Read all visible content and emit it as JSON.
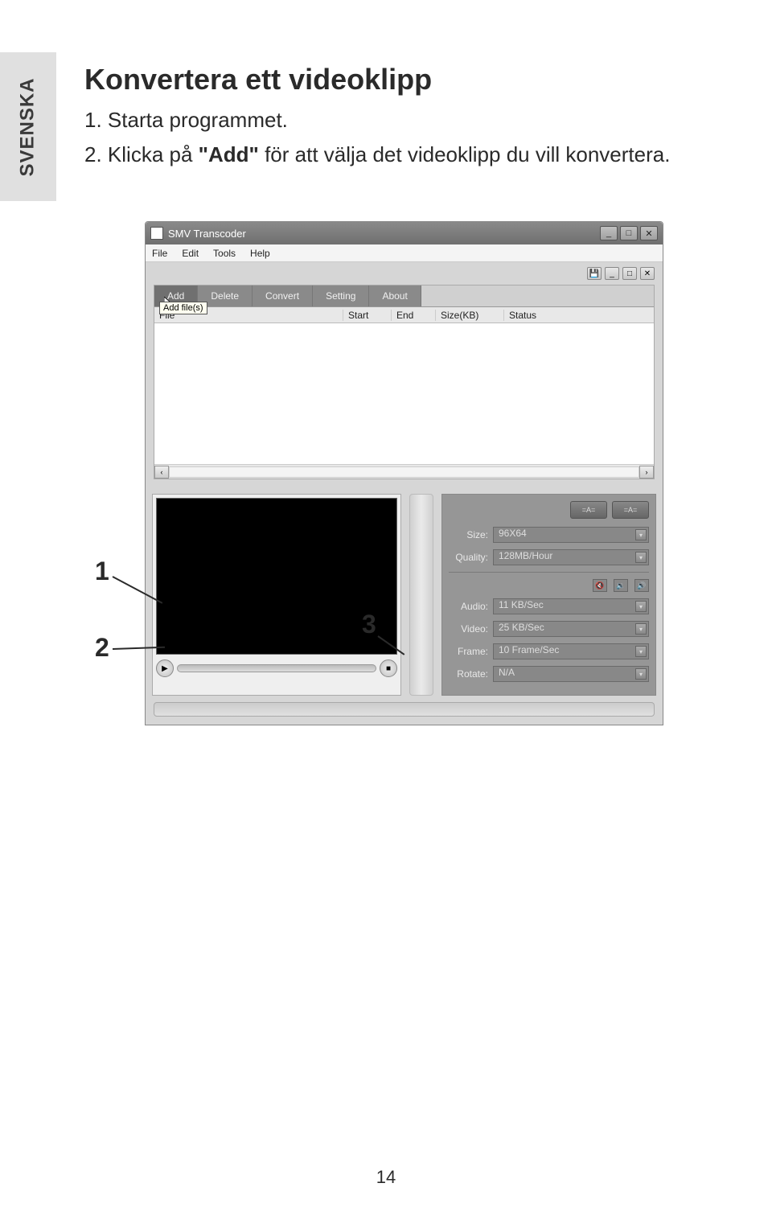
{
  "sidebar_label": "SVENSKA",
  "heading": "Konvertera ett videoklipp",
  "steps": {
    "s1_num": "1.",
    "s1_text": "Starta programmet.",
    "s2_num": "2.",
    "s2_pre": "Klicka på ",
    "s2_bold": "\"Add\"",
    "s2_post": " för att välja det videoklipp du vill konvertera."
  },
  "app": {
    "title": "SMV Transcoder",
    "menu": {
      "file": "File",
      "edit": "Edit",
      "tools": "Tools",
      "help": "Help"
    },
    "tabs": {
      "add": "Add",
      "delete": "Delete",
      "convert": "Convert",
      "setting": "Setting",
      "about": "About"
    },
    "tooltip": "Add file(s)",
    "columns": {
      "file": "File",
      "start": "Start",
      "end": "End",
      "size": "Size(KB)",
      "status": "Status"
    },
    "settings": {
      "size_label": "Size:",
      "size_value": "96X64",
      "quality_label": "Quality:",
      "quality_value": "128MB/Hour",
      "audio_label": "Audio:",
      "audio_value": "11 KB/Sec",
      "video_label": "Video:",
      "video_value": "25 KB/Sec",
      "frame_label": "Frame:",
      "frame_value": "10 Frame/Sec",
      "rotate_label": "Rotate:",
      "rotate_value": "N/A",
      "icon_a": "=A=",
      "icon_b": "=A="
    }
  },
  "callouts": {
    "c1": "1",
    "c2": "2",
    "c3": "3"
  },
  "page_number": "14"
}
